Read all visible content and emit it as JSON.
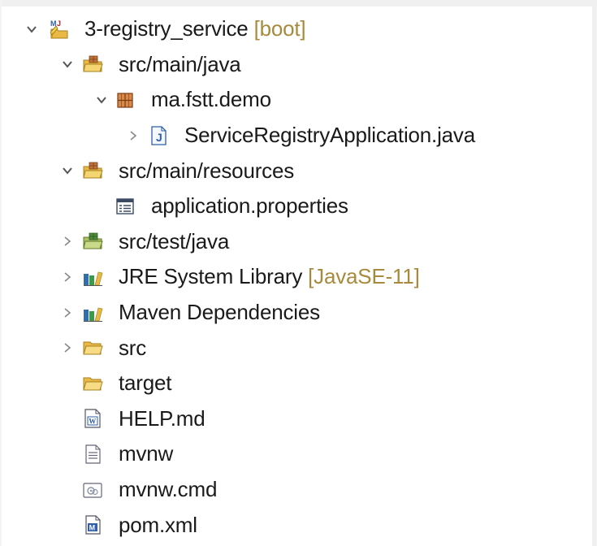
{
  "project": {
    "name": "3-registry_service",
    "decoration": "[boot]"
  },
  "items": [
    {
      "label": "src/main/java",
      "decoration": ""
    },
    {
      "label": "ma.fstt.demo",
      "decoration": ""
    },
    {
      "label": "ServiceRegistryApplication.java",
      "decoration": ""
    },
    {
      "label": "src/main/resources",
      "decoration": ""
    },
    {
      "label": "application.properties",
      "decoration": ""
    },
    {
      "label": "src/test/java",
      "decoration": ""
    },
    {
      "label": "JRE System Library",
      "decoration": "[JavaSE-11]"
    },
    {
      "label": "Maven Dependencies",
      "decoration": ""
    },
    {
      "label": "src",
      "decoration": ""
    },
    {
      "label": "target",
      "decoration": ""
    },
    {
      "label": "HELP.md",
      "decoration": ""
    },
    {
      "label": "mvnw",
      "decoration": ""
    },
    {
      "label": "mvnw.cmd",
      "decoration": ""
    },
    {
      "label": "pom.xml",
      "decoration": ""
    }
  ],
  "icons": {
    "project": "maven-project-icon",
    "source_folder": "source-folder-icon",
    "package": "package-icon",
    "java_file": "java-file-icon",
    "properties_file": "properties-file-icon",
    "library": "library-icon",
    "folder": "folder-icon",
    "markdown_file": "markdown-file-icon",
    "text_file": "text-file-icon",
    "cmd_file": "cmd-file-icon",
    "maven_pom": "maven-pom-icon"
  },
  "colors": {
    "decoration": "#a88a3c",
    "twisty": "#555555",
    "folder": "#e9b845",
    "java_blue": "#2f5fa8"
  }
}
